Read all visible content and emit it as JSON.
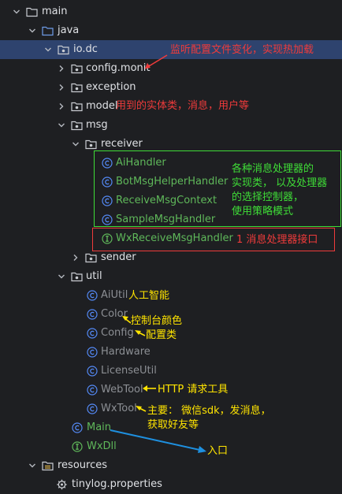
{
  "colors": {
    "background": "#1e1f22",
    "selection": "#2e436e",
    "text": "#dfe1e5",
    "test_green": "#5fb85a",
    "class_icon": "#548af7",
    "interface_icon": "#5fb85a",
    "annot_red": "#ef3b3b",
    "annot_yellow": "#ffe400",
    "annot_green": "#3fdd37",
    "arrow_blue": "#1e90e0"
  },
  "tree": {
    "main": "main",
    "java": "java",
    "io_dc": "io.dc",
    "config_monit": "config.monit",
    "exception": "exception",
    "model": "model",
    "msg": "msg",
    "receiver": "receiver",
    "ai_handler": "AiHandler",
    "bot_msg_helper_handler": "BotMsgHelperHandler",
    "receive_msg_context": "ReceiveMsgContext",
    "sample_msg_handler": "SampleMsgHandler",
    "wx_receive_msg_handler": "WxReceiveMsgHandler",
    "sender": "sender",
    "util": "util",
    "ai_util": "AiUtil",
    "color": "Color",
    "config": "Config",
    "hardware": "Hardware",
    "license_util": "LicenseUtil",
    "web_tool": "WebTool",
    "wx_tool": "WxTool",
    "main_class": "Main",
    "wx_dll": "WxDll",
    "resources": "resources",
    "tinylog": "tinylog.properties"
  },
  "annotations": {
    "config_monit": "监听配置文件变化，实现热加载",
    "model": "用到的实体类，消息，用户等",
    "handlers_line1": "各种消息处理器的",
    "handlers_line2": "实现类，  以及处理器",
    "handlers_line3": "的选择控制器，",
    "handlers_line4": "使用策略模式",
    "interface": "1 消息处理器接口",
    "ai_util": "人工智能",
    "color": "控制台颜色",
    "config": "配置类",
    "web_tool": "HTTP 请求工具",
    "wx_tool_line1": "主要：  微信sdk，发消息，",
    "wx_tool_line2": "获取好友等",
    "main": "入口"
  }
}
